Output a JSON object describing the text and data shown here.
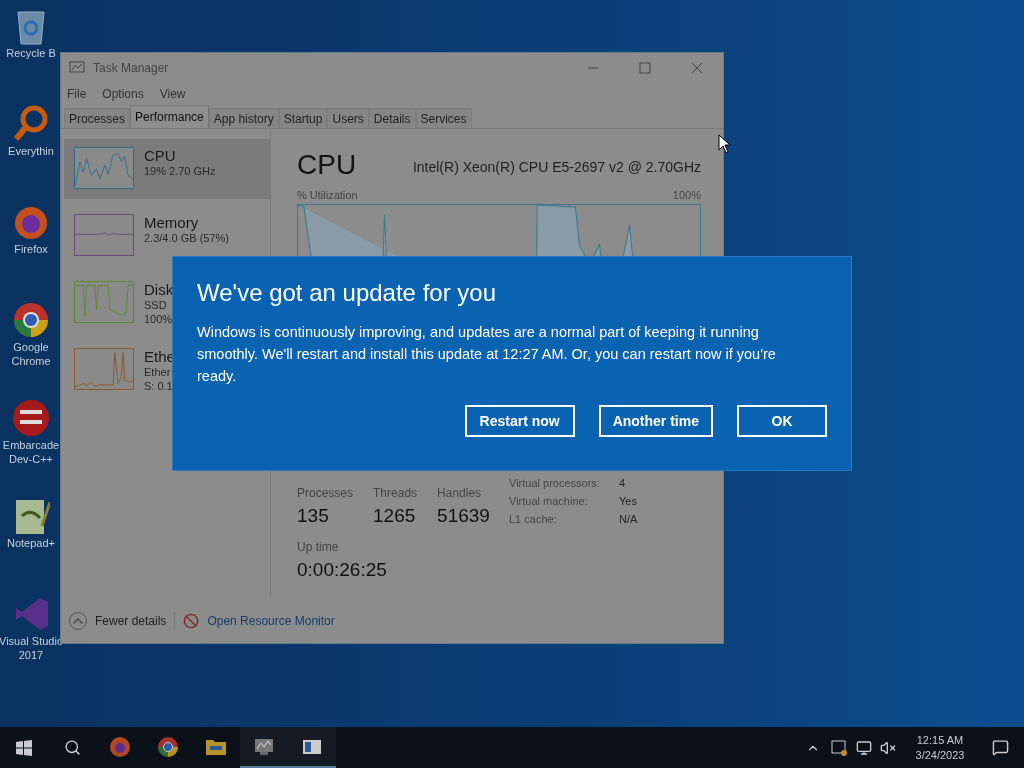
{
  "desktop_icons": [
    {
      "kind": "recycle",
      "label_lines": [
        "Recycle B"
      ]
    },
    {
      "kind": "search",
      "label_lines": [
        "Everythin"
      ]
    },
    {
      "kind": "firefox",
      "label_lines": [
        "Firefox"
      ]
    },
    {
      "kind": "chrome",
      "label_lines": [
        "Google",
        "Chrome"
      ]
    },
    {
      "kind": "dev",
      "label_lines": [
        "Embarcade",
        "Dev-C++"
      ]
    },
    {
      "kind": "notepad",
      "label_lines": [
        "Notepad+"
      ]
    },
    {
      "kind": "vs",
      "label_lines": [
        "Visual Studio",
        "2017"
      ]
    }
  ],
  "task_manager": {
    "title": "Task Manager",
    "menu": [
      "File",
      "Options",
      "View"
    ],
    "tabs": [
      {
        "label": "Processes",
        "selected": false
      },
      {
        "label": "Performance",
        "selected": true
      },
      {
        "label": "App history",
        "selected": false
      },
      {
        "label": "Startup",
        "selected": false
      },
      {
        "label": "Users",
        "selected": false
      },
      {
        "label": "Details",
        "selected": false
      },
      {
        "label": "Services",
        "selected": false
      }
    ],
    "resources": [
      {
        "name": "CPU",
        "lines": [
          "19% 2.70 GHz"
        ],
        "selected": true,
        "color": "#2f6e8a"
      },
      {
        "name": "Memory",
        "lines": [
          "2.3/4.0 GB (57%)"
        ],
        "selected": false,
        "color": "#6a4a78"
      },
      {
        "name": "Disk",
        "lines": [
          "SSD",
          "100%"
        ],
        "selected": false,
        "color": "#5a8a2a"
      },
      {
        "name": "Ethe",
        "lines": [
          "Ether",
          "S: 0.1"
        ],
        "selected": false,
        "color": "#8a5a2a"
      }
    ],
    "detail": {
      "heading": "CPU",
      "processor": "Intel(R) Xeon(R) CPU E5-2697 v2 @ 2.70GHz",
      "graph_label": "% Utilization",
      "graph_max": "100%",
      "stats": [
        {
          "label": "Processes",
          "value": "135"
        },
        {
          "label": "Threads",
          "value": "1265"
        },
        {
          "label": "Handles",
          "value": "51639"
        }
      ],
      "uptime": {
        "label": "Up time",
        "value": "0:00:26:25"
      },
      "specs": [
        {
          "label": "Virtual processors:",
          "value": "4"
        },
        {
          "label": "Virtual machine:",
          "value": "Yes"
        },
        {
          "label": "L1 cache:",
          "value": "N/A"
        }
      ]
    },
    "footer": {
      "fewer": "Fewer details",
      "link": "Open Resource Monitor"
    }
  },
  "dialog": {
    "title": "We've got an update for you",
    "body": "Windows is continuously improving, and updates are a normal part of keeping it running smoothly. We'll restart and install this update at 12:27 AM. Or, you can restart now if you're ready.",
    "buttons": [
      "Restart now",
      "Another time",
      "OK"
    ]
  },
  "taskbar": {
    "apps": [
      {
        "kind": "firefox",
        "active": false
      },
      {
        "kind": "chrome",
        "active": false
      },
      {
        "kind": "folder",
        "active": false
      },
      {
        "kind": "taskmgr",
        "active": true
      },
      {
        "kind": "window",
        "active": true
      }
    ],
    "time": "12:15 AM",
    "date": "3/24/2023"
  }
}
